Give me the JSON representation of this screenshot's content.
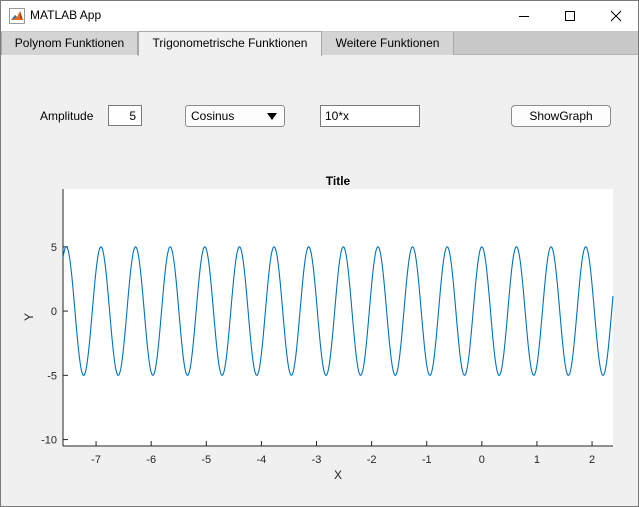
{
  "window": {
    "title": "MATLAB App",
    "icon": "matlab-logo-icon"
  },
  "tabs": [
    {
      "label": "Polynom Funktionen",
      "selected": false
    },
    {
      "label": "Trigonometrische Funktionen",
      "selected": true
    },
    {
      "label": "Weitere Funktionen",
      "selected": false
    }
  ],
  "controls": {
    "amplitude_label": "Amplitude",
    "amplitude_value": "5",
    "function_select": "Cosinus",
    "expression_value": "10*x",
    "show_button": "ShowGraph"
  },
  "chart_data": {
    "type": "line",
    "title": "Title",
    "xlabel": "X",
    "ylabel": "Y",
    "xlim": [
      -7.6,
      2.38
    ],
    "ylim": [
      -10.5,
      9.5
    ],
    "xticks": [
      -7,
      -6,
      -5,
      -4,
      -3,
      -2,
      -1,
      0,
      1,
      2
    ],
    "yticks": [
      -10,
      -5,
      0,
      5
    ],
    "grid": false,
    "series": [
      {
        "function": "5*cos(10*x)",
        "amplitude": 5,
        "angular_frequency": 10,
        "x_range": [
          -7.6,
          2.38
        ],
        "color": "#0072bd"
      }
    ]
  }
}
